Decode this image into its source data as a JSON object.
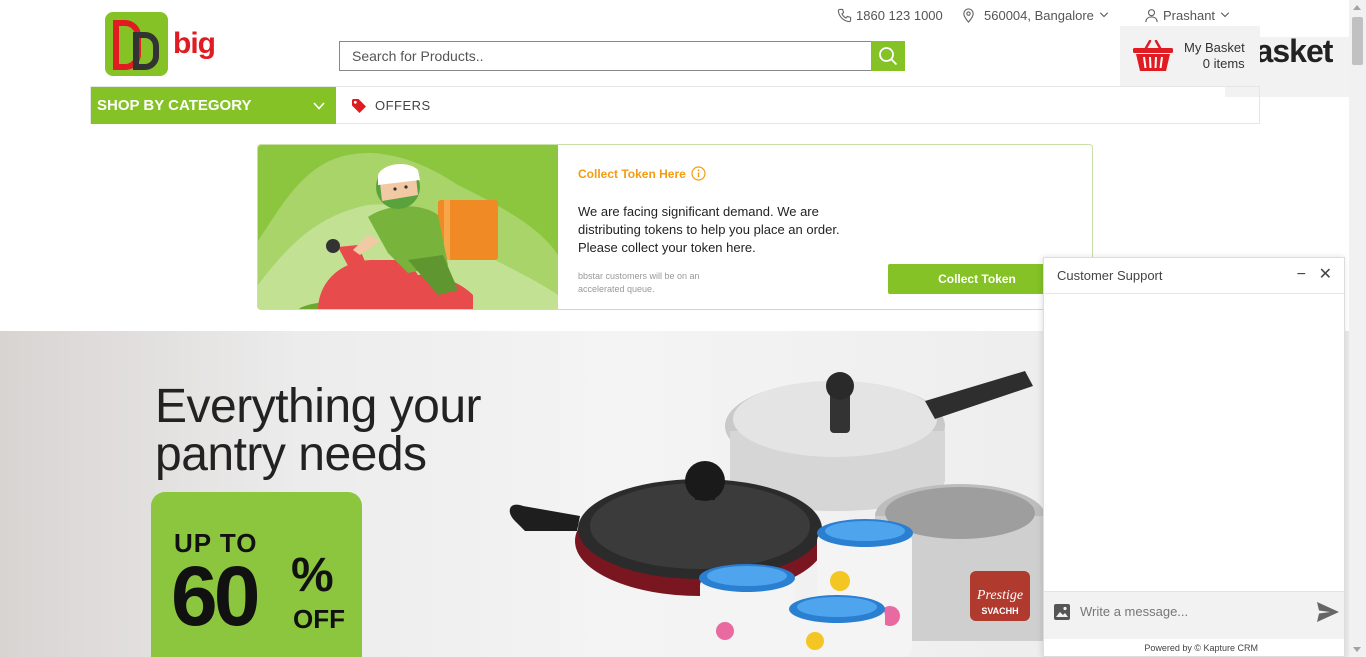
{
  "brand": {
    "name_top": "big",
    "name_bottom": "basket",
    "accent": "#84c225",
    "red": "#e11b22"
  },
  "header": {
    "phone": "1860 123 1000",
    "location": "560004, Bangalore",
    "user": "Prashant",
    "basket_title": "My Basket",
    "basket_count": "0 items"
  },
  "search": {
    "placeholder": "Search for Products..",
    "value": ""
  },
  "nav": {
    "shop_by_category": "SHOP BY CATEGORY",
    "offers": "OFFERS"
  },
  "token_banner": {
    "heading": "Collect Token Here",
    "message": "We are facing significant demand. We are distributing tokens to help you place an order. Please collect your token here.",
    "note": "bbstar customers will be on an accelerated queue.",
    "button": "Collect Token"
  },
  "hero": {
    "line1": "Everything your",
    "line2": "pantry needs",
    "promo_upto": "UP TO",
    "promo_value": "60",
    "promo_pct": "%",
    "promo_off": "OFF",
    "product_brand": "Prestige",
    "product_name": "SVACHH"
  },
  "chat": {
    "title": "Customer Support",
    "minimize": "−",
    "close": "✕",
    "input_placeholder": "Write a message...",
    "footer": "Powered by © Kapture CRM"
  }
}
